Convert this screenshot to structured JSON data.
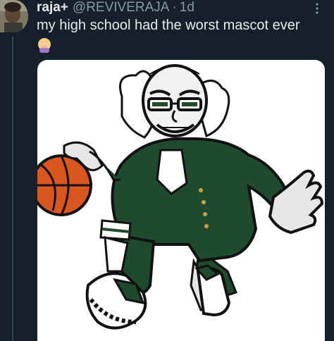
{
  "tweet": {
    "author_name": "raja+",
    "handle": "@REVIVERAJA",
    "separator": "·",
    "time": "1d",
    "text": "my high school had the worst mascot ever",
    "emoji_icon": "woman-facepalming-emoji",
    "media_icon": "mascot-basketball-image"
  },
  "colors": {
    "background": "#15202b",
    "text_primary": "#e7e9ea",
    "text_secondary": "#8b98a5",
    "mascot_green": "#1f4a2e"
  }
}
